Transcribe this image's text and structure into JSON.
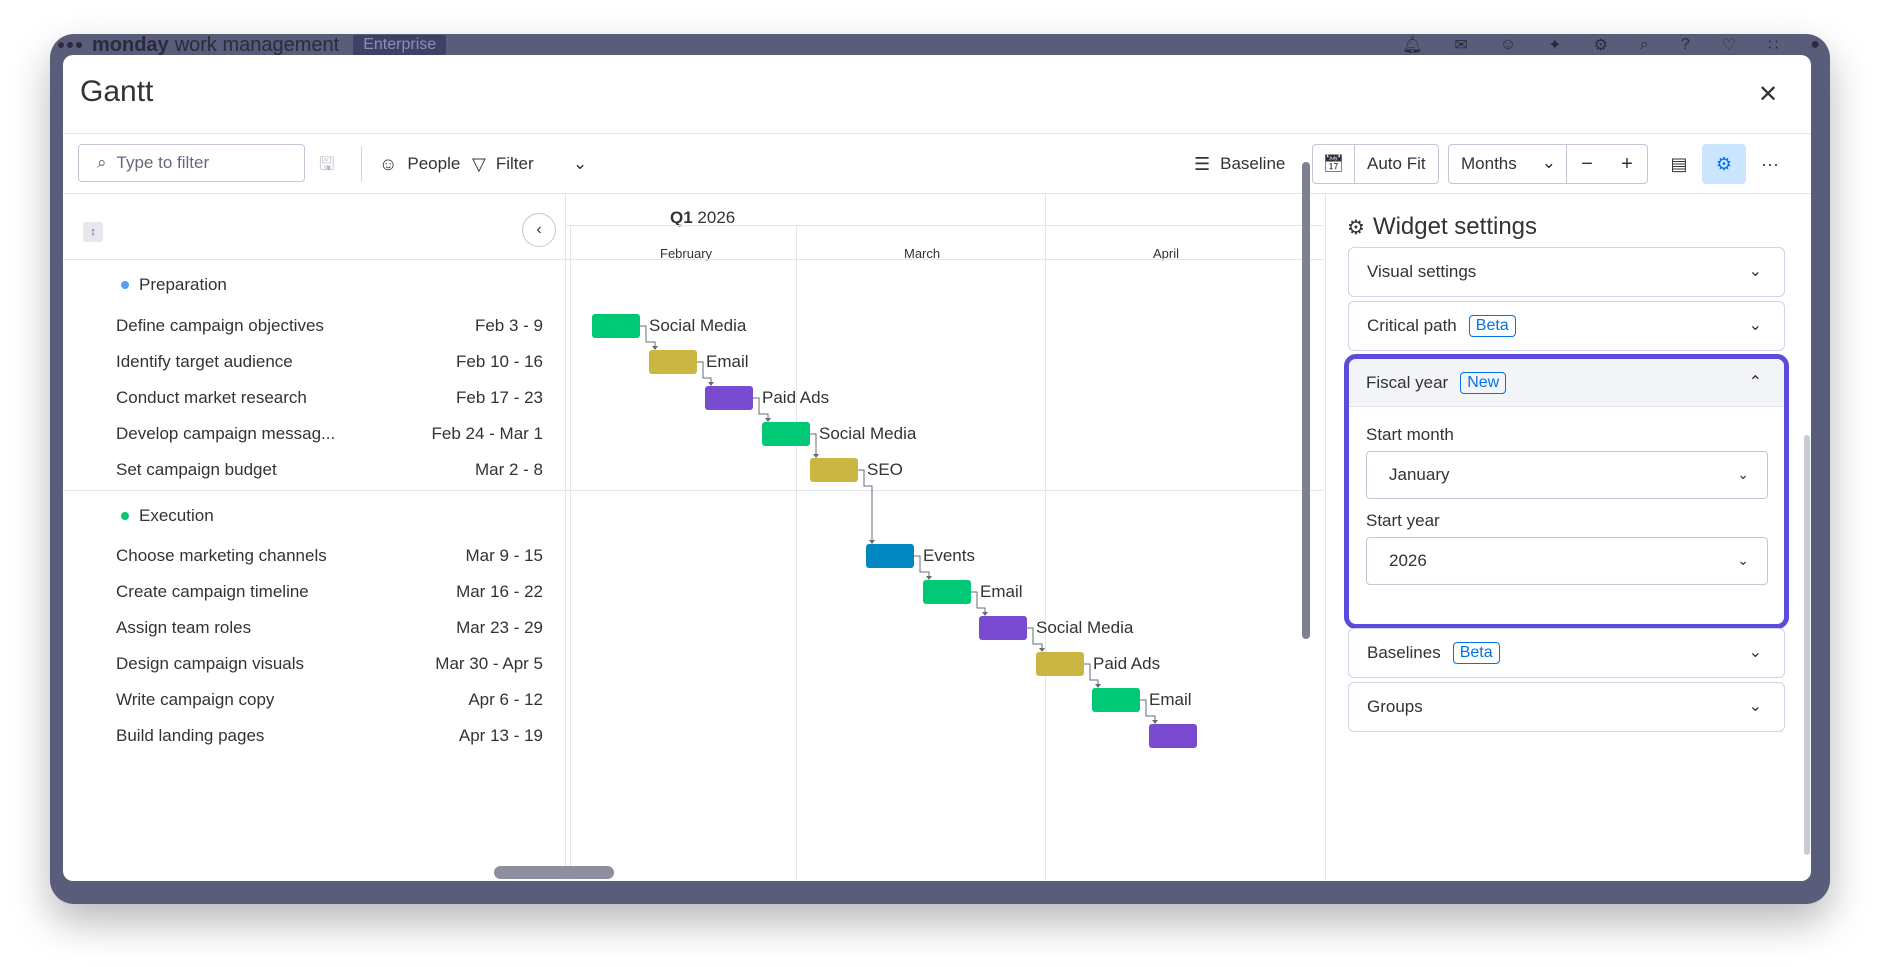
{
  "app": {
    "brand": "monday",
    "product": "work management",
    "plan": "Enterprise"
  },
  "modal": {
    "title": "Gantt",
    "close_icon": "close-icon"
  },
  "toolbar": {
    "search_placeholder": "Type to filter",
    "people_label": "People",
    "filter_label": "Filter",
    "baseline_label": "Baseline",
    "auto_fit_label": "Auto Fit",
    "zoom_value": "Months",
    "zoom_out": "−",
    "zoom_in": "+",
    "more": "···"
  },
  "timeline": {
    "quarter_bold": "Q1",
    "quarter_year": "2026",
    "months": [
      "February",
      "March",
      "April"
    ]
  },
  "groups": [
    {
      "name": "Preparation",
      "color": "#579bfc",
      "tasks": [
        {
          "name": "Define campaign objectives",
          "dates": "Feb 3 - 9",
          "bar_label": "Social Media",
          "bar_color": "#00c875"
        },
        {
          "name": "Identify target audience",
          "dates": "Feb 10 - 16",
          "bar_label": "Email",
          "bar_color": "#cab641"
        },
        {
          "name": "Conduct market research",
          "dates": "Feb 17 - 23",
          "bar_label": "Paid Ads",
          "bar_color": "#784bd1"
        },
        {
          "name": "Develop campaign messag...",
          "dates": "Feb 24 - Mar 1",
          "bar_label": "Social Media",
          "bar_color": "#00c875"
        },
        {
          "name": "Set campaign budget",
          "dates": "Mar 2 - 8",
          "bar_label": "SEO",
          "bar_color": "#cab641"
        }
      ]
    },
    {
      "name": "Execution",
      "color": "#00c875",
      "tasks": [
        {
          "name": "Choose marketing channels",
          "dates": "Mar 9 - 15",
          "bar_label": "Events",
          "bar_color": "#0086c0"
        },
        {
          "name": "Create campaign timeline",
          "dates": "Mar 16 - 22",
          "bar_label": "Email",
          "bar_color": "#00c875"
        },
        {
          "name": "Assign team roles",
          "dates": "Mar 23 - 29",
          "bar_label": "Social Media",
          "bar_color": "#784bd1"
        },
        {
          "name": "Design campaign visuals",
          "dates": "Mar 30 - Apr 5",
          "bar_label": "Paid Ads",
          "bar_color": "#cab641"
        },
        {
          "name": "Write campaign copy",
          "dates": "Apr 6 - 12",
          "bar_label": "Email",
          "bar_color": "#00c875"
        },
        {
          "name": "Build landing pages",
          "dates": "Apr 13 - 19",
          "bar_label": "",
          "bar_color": "#784bd1"
        }
      ]
    }
  ],
  "settings": {
    "title": "Widget settings",
    "visual_settings": "Visual settings",
    "critical_path": "Critical path",
    "critical_path_badge": "Beta",
    "fiscal_year": "Fiscal year",
    "fiscal_year_badge": "New",
    "start_month_label": "Start month",
    "start_month_value": "January",
    "start_year_label": "Start year",
    "start_year_value": "2026",
    "baselines": "Baselines",
    "baselines_badge": "Beta",
    "groups": "Groups",
    "highlight_color": "#5b4cdb"
  }
}
